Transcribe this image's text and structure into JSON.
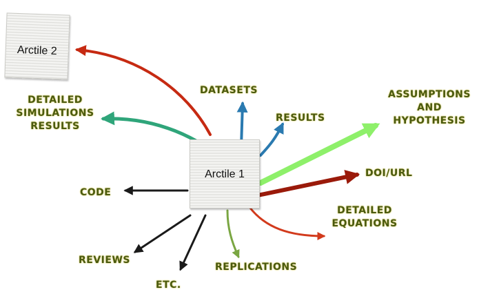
{
  "nodes": {
    "article_1": "Arctile 1",
    "article_2": "Arctile 2"
  },
  "labels": {
    "datasets": "DATASETS",
    "results": "RESULTS",
    "detailed_sim_line1": "DETAILED",
    "detailed_sim_line2": "SIMULATIONS",
    "detailed_sim_line3": "RESULTS",
    "assumptions_line1": "ASSUMPTIONS",
    "assumptions_line2": "AND",
    "assumptions_line3": "HYPOTHESIS",
    "doi": "DOI/URL",
    "code": "CODE",
    "detailed_eq_line1": "DETAILED",
    "detailed_eq_line2": "EQUATIONS",
    "reviews": "REVIEWS",
    "etc": "ETC.",
    "replications": "REPLICATIONS"
  },
  "colors": {
    "label_text": "#4a5a10",
    "red_arrow": "#c62a12",
    "teal_arrow": "#2fa57a",
    "blue_arrow": "#2a7ab0",
    "light_green_arrow": "#8ef06a",
    "dark_red_arrow": "#9a1a0a",
    "black_arrow": "#1a1a1a",
    "olive_arrow": "#7aa642"
  }
}
